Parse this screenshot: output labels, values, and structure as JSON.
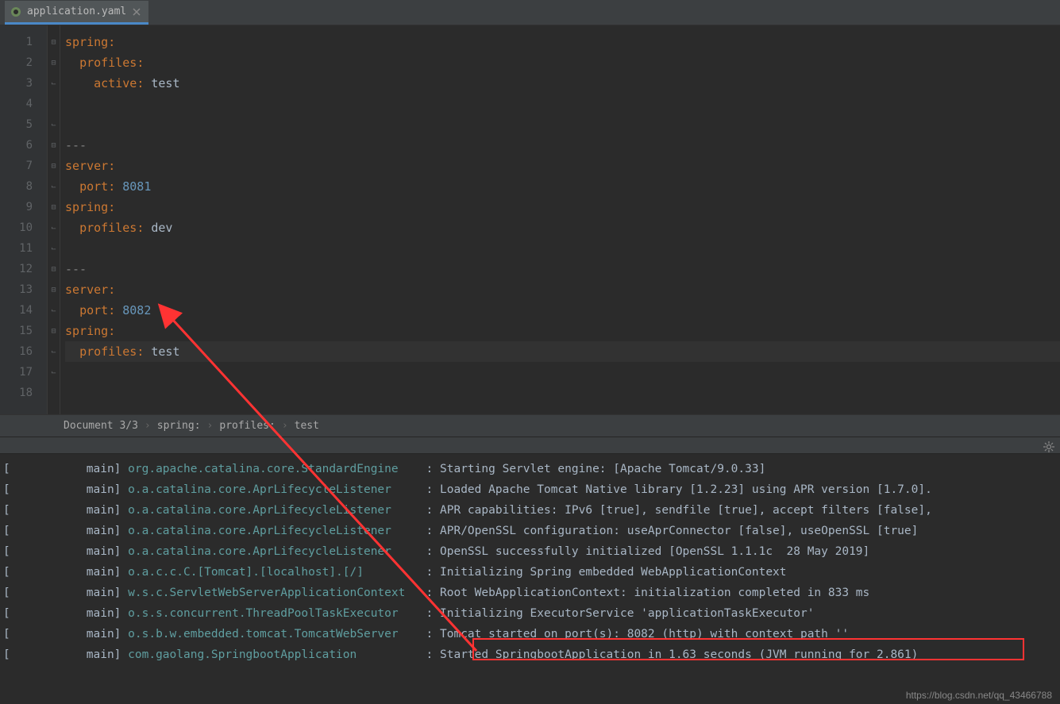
{
  "tab": {
    "filename": "application.yaml"
  },
  "gutter": {
    "lines": [
      "1",
      "2",
      "3",
      "4",
      "5",
      "6",
      "7",
      "8",
      "9",
      "10",
      "11",
      "12",
      "13",
      "14",
      "15",
      "16",
      "17",
      "18"
    ]
  },
  "code": {
    "l1_key": "spring",
    "l2_key": "profiles",
    "l3_key": "active",
    "l3_val": "test",
    "l6_sep": "---",
    "l7_key": "server",
    "l8_key": "port",
    "l8_val": "8081",
    "l9_key": "spring",
    "l10_key": "profiles",
    "l10_val": "dev",
    "l12_sep": "---",
    "l13_key": "server",
    "l14_key": "port",
    "l14_val": "8082",
    "l15_key": "spring",
    "l16_key": "profiles",
    "l16_val": "test"
  },
  "breadcrumb": {
    "doc": "Document 3/3",
    "p1": "spring:",
    "p2": "profiles:",
    "p3": "test"
  },
  "console": {
    "lines": [
      {
        "thread": "main",
        "logger": "org.apache.catalina.core.StandardEngine",
        "msg": "Starting Servlet engine: [Apache Tomcat/9.0.33]",
        "cut": true
      },
      {
        "thread": "main",
        "logger": "o.a.catalina.core.AprLifecycleListener",
        "msg": "Loaded Apache Tomcat Native library [1.2.23] using APR version [1.7.0]."
      },
      {
        "thread": "main",
        "logger": "o.a.catalina.core.AprLifecycleListener",
        "msg": "APR capabilities: IPv6 [true], sendfile [true], accept filters [false],"
      },
      {
        "thread": "main",
        "logger": "o.a.catalina.core.AprLifecycleListener",
        "msg": "APR/OpenSSL configuration: useAprConnector [false], useOpenSSL [true]"
      },
      {
        "thread": "main",
        "logger": "o.a.catalina.core.AprLifecycleListener",
        "msg": "OpenSSL successfully initialized [OpenSSL 1.1.1c  28 May 2019]"
      },
      {
        "thread": "main",
        "logger": "o.a.c.c.C.[Tomcat].[localhost].[/]",
        "msg": "Initializing Spring embedded WebApplicationContext"
      },
      {
        "thread": "main",
        "logger": "w.s.c.ServletWebServerApplicationContext",
        "msg": "Root WebApplicationContext: initialization completed in 833 ms"
      },
      {
        "thread": "main",
        "logger": "o.s.s.concurrent.ThreadPoolTaskExecutor",
        "msg": "Initializing ExecutorService 'applicationTaskExecutor'"
      },
      {
        "thread": "main",
        "logger": "o.s.b.w.embedded.tomcat.TomcatWebServer",
        "msg": "Tomcat started on port(s): 8082 (http) with context path ''"
      },
      {
        "thread": "main",
        "logger": "com.gaolang.SpringbootApplication",
        "msg": "Started SpringbootApplication in 1.63 seconds (JVM running for 2.861)"
      }
    ]
  },
  "watermark": "https://blog.csdn.net/qq_43466788"
}
